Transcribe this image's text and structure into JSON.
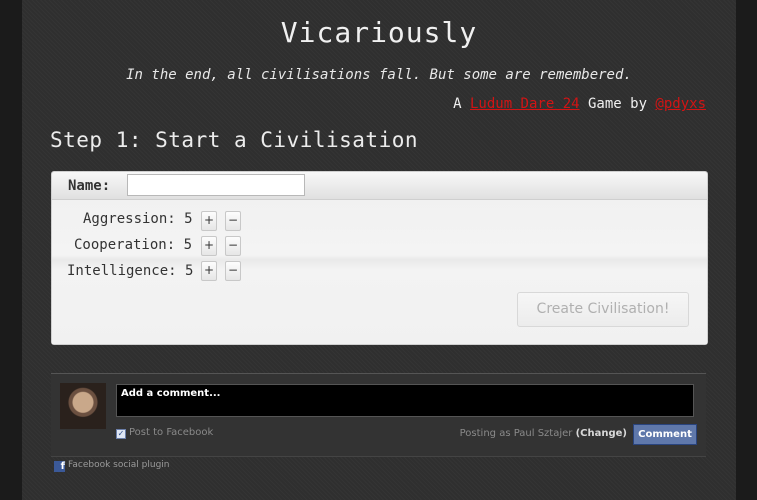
{
  "header": {
    "title": "Vicariously",
    "tagline": "In the end, all civilisations fall. But some are remembered.",
    "byline_prefix": "A ",
    "byline_link1": "Ludum Dare 24",
    "byline_middle": " Game by ",
    "byline_link2": "@pdyxs"
  },
  "step": {
    "title": "Step 1: Start a Civilisation"
  },
  "form": {
    "name_label": "Name:",
    "name_value": "",
    "stats": [
      {
        "label": "Aggression:",
        "value": "5"
      },
      {
        "label": "Cooperation:",
        "value": "5"
      },
      {
        "label": "Intelligence:",
        "value": "5"
      }
    ],
    "plus_label": "+",
    "minus_label": "−",
    "create_button": "Create Civilisation!"
  },
  "facebook": {
    "comment_placeholder": "Add a comment...",
    "post_to_facebook": "Post to Facebook",
    "post_checked": true,
    "posting_as": "Posting as Paul Sztajer",
    "change_label": "(Change)",
    "comment_button": "Comment",
    "plugin_label": "Facebook social plugin"
  }
}
